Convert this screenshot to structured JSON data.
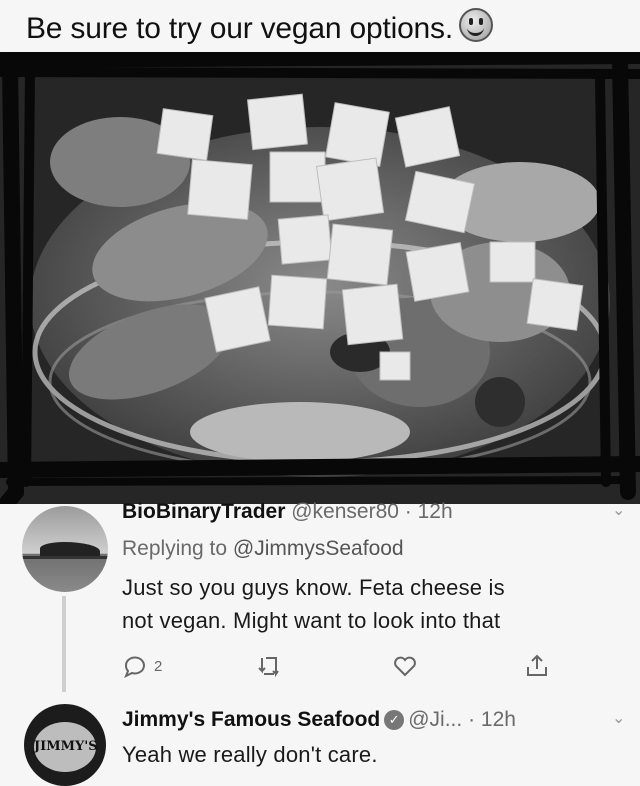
{
  "caption": {
    "text": "Be sure to try our vegan options."
  },
  "reply_tweet": {
    "display_name": "BioBinaryTrader",
    "handle": "@kenser80",
    "time": "12h",
    "replying_prefix": "Replying to ",
    "replying_to": "@JimmysSeafood",
    "text_line1": "Just so you guys know. Feta cheese is",
    "text_line2": "not vegan.  Might want to look into that",
    "reply_count": "2",
    "icons": [
      "reply-icon",
      "retweet-icon",
      "like-icon",
      "share-icon"
    ]
  },
  "brand_tweet": {
    "display_name": "Jimmy's Famous Seafood",
    "handle": "@Ji...",
    "time": "12h",
    "text": "Yeah we really don't care.",
    "avatar_text": "JIMMY'S"
  }
}
